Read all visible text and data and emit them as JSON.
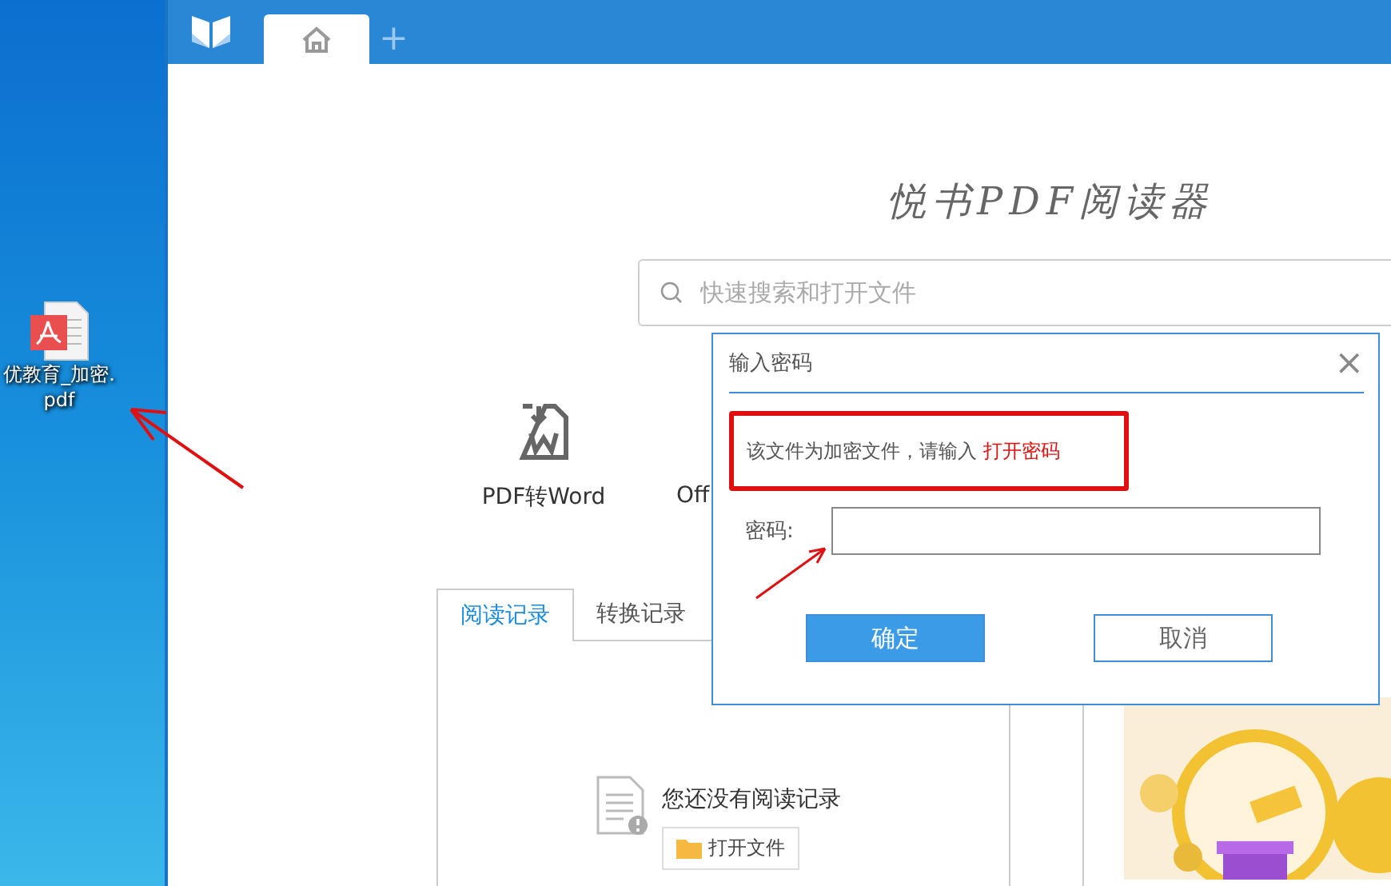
{
  "desktop": {
    "file_icon": {
      "label_lines": [
        "优教育_加密.",
        "pdf"
      ]
    }
  },
  "app": {
    "tabs": [
      {
        "kind": "home",
        "selected": true
      },
      {
        "kind": "add",
        "label": "+",
        "selected": false
      }
    ],
    "title": "悦书PDF阅读器",
    "search": {
      "placeholder": "快速搜索和打开文件"
    },
    "features": [
      {
        "label": "PDF转Word",
        "kind": "word"
      },
      {
        "label": "Off",
        "kind": "hidden"
      }
    ],
    "records": {
      "tabs": [
        {
          "label": "阅读记录",
          "selected": true
        },
        {
          "label": "转换记录",
          "selected": false
        }
      ],
      "empty_text": "您还没有阅读记录",
      "open_button": "打开文件"
    }
  },
  "dialog": {
    "title": "输入密码",
    "close": "×",
    "message": "该文件为加密文件，请输入 ",
    "message_highlight": "打开密码",
    "password_label": "密码:",
    "buttons": [
      {
        "label": "确定",
        "kind": "primary"
      },
      {
        "label": "取消",
        "kind": "secondary"
      }
    ]
  }
}
